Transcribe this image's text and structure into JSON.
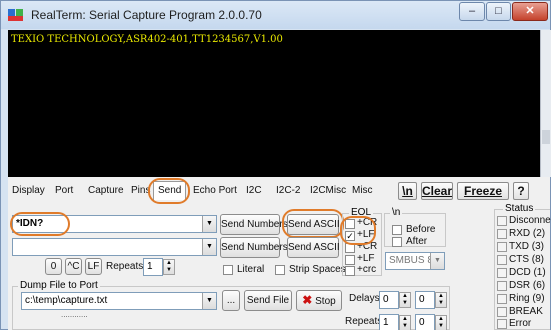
{
  "window": {
    "title": "RealTerm: Serial Capture Program 2.0.0.70",
    "controls": {
      "minimize": "–",
      "maximize": "□",
      "close": "✕"
    }
  },
  "terminal": {
    "line1": "TEXIO TECHNOLOGY,ASR402-401,TT1234567,V1.00",
    "text_color": "#e8e800",
    "background": "#000000"
  },
  "tabs": [
    "Display",
    "Port",
    "Capture",
    "Pins",
    "Send",
    "Echo Port",
    "I2C",
    "I2C-2",
    "I2CMisc",
    "Misc"
  ],
  "active_tab": "Send",
  "toolbar_right": {
    "newline": "\\n",
    "clear": "Clear",
    "freeze": "Freeze",
    "help": "?"
  },
  "send": {
    "row1_value": "*IDN?",
    "row2_value": "",
    "send_numbers_1": "Send Numbers",
    "send_ascii_1": "Send ASCII",
    "send_numbers_2": "Send Numbers",
    "send_ascii_2": "Send ASCII",
    "zero_btn": "0",
    "ctrl_c_btn": "^C",
    "lf_btn": "LF",
    "repeats_label": "Repeats",
    "repeats_value": "1",
    "literal_label": "Literal",
    "strip_spaces_label": "Strip Spaces",
    "eol_title": "EOL",
    "eol_items": [
      "+CR",
      "+LF",
      "+CR",
      "+LF",
      "+crc"
    ],
    "eol_checked": [
      false,
      true,
      false,
      false,
      false
    ],
    "newline_title": "\\n",
    "before_label": "Before",
    "after_label": "After",
    "smbus_value": "SMBUS 8"
  },
  "dump": {
    "title": "Dump File to Port",
    "path": "c:\\temp\\capture.txt",
    "browse_btn": "...",
    "send_file_btn": "Send File",
    "stop_btn": "Stop",
    "delays_label": "Delays",
    "delay1": "0",
    "delay2": "0",
    "repeats_label": "Repeats",
    "repeats1": "1",
    "repeats2": "0",
    "progress_text": "............"
  },
  "status": {
    "title": "Status",
    "items": [
      "Disconnect",
      "RXD (2)",
      "TXD (3)",
      "CTS (8)",
      "DCD (1)",
      "DSR (6)",
      "Ring (9)",
      "BREAK",
      "Error"
    ]
  },
  "colors": {
    "highlight": "#e07b2a",
    "stop_icon": "#cc1111"
  }
}
